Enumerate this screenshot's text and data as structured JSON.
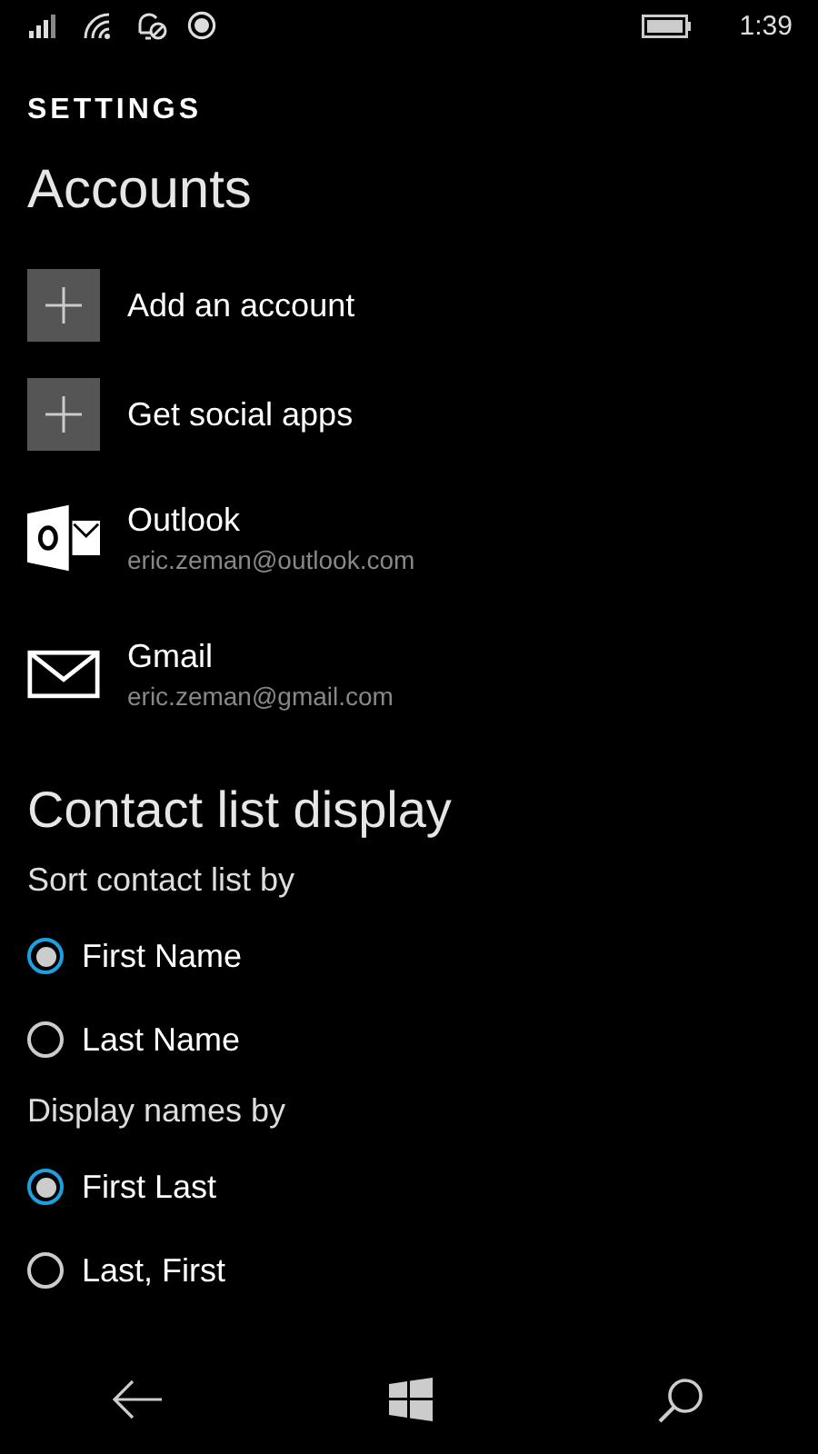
{
  "status_bar": {
    "time": "1:39"
  },
  "page_title": "SETTINGS",
  "accounts": {
    "heading": "Accounts",
    "items": [
      {
        "kind": "add",
        "label": "Add an account"
      },
      {
        "kind": "add",
        "label": "Get social apps"
      },
      {
        "kind": "outlook",
        "label": "Outlook",
        "email": "eric.zeman@outlook.com"
      },
      {
        "kind": "mail",
        "label": "Gmail",
        "email": "eric.zeman@gmail.com"
      }
    ]
  },
  "contact_list_display": {
    "heading": "Contact list display",
    "groups": [
      {
        "label": "Sort contact list by",
        "options": [
          {
            "label": "First Name",
            "selected": true
          },
          {
            "label": "Last Name",
            "selected": false
          }
        ]
      },
      {
        "label": "Display names by",
        "options": [
          {
            "label": "First Last",
            "selected": true
          },
          {
            "label": "Last, First",
            "selected": false
          }
        ]
      }
    ]
  }
}
